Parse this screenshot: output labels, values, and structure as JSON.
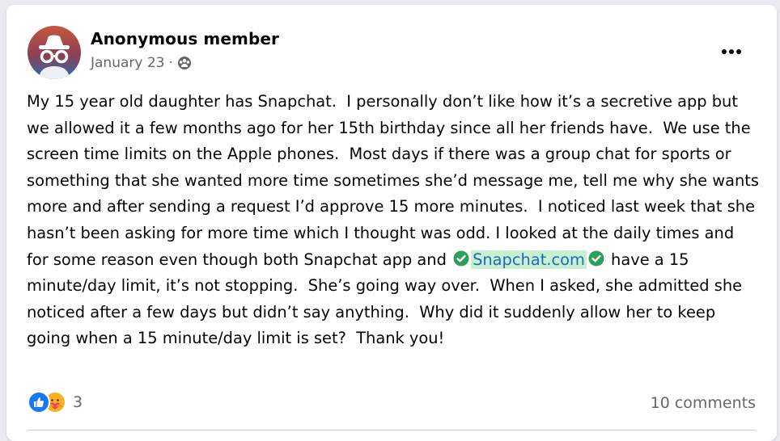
{
  "post": {
    "author": "Anonymous member",
    "date": "January 23",
    "separator": "·",
    "body": {
      "before_link": "My 15 year old daughter has Snapchat.  I personally don’t like how it’s a secretive app but we allowed it a few months ago for her 15th birthday since all her friends have.  We use the screen time limits on the Apple phones.  Most days if there was a group chat for sports or something that she wanted more time sometimes she’d message me, tell me why she wants more and after sending a request I’d approve 15 more minutes.  I noticed last week that she hasn’t been asking for more time which I thought was odd. I looked at the daily times and for some reason even though both Snapchat app and ",
      "link": "Snapchat.com",
      "after_link": " have a 15 minute/day limit, it’s not stopping.  She’s going way over.  When I asked, she admitted she noticed after a few days but didn’t say anything.  Why did it suddenly allow her to keep going when a 15 minute/day limit is set?  Thank you!"
    },
    "reactions": {
      "count": "3",
      "types": [
        "like-icon",
        "care-icon"
      ]
    },
    "comments": "10 comments"
  },
  "colors": {
    "link": "#1f6bbd",
    "link_highlight": "#c6f0cf",
    "verify_green": "#2e9e5b",
    "like_blue": "#1877f2"
  }
}
